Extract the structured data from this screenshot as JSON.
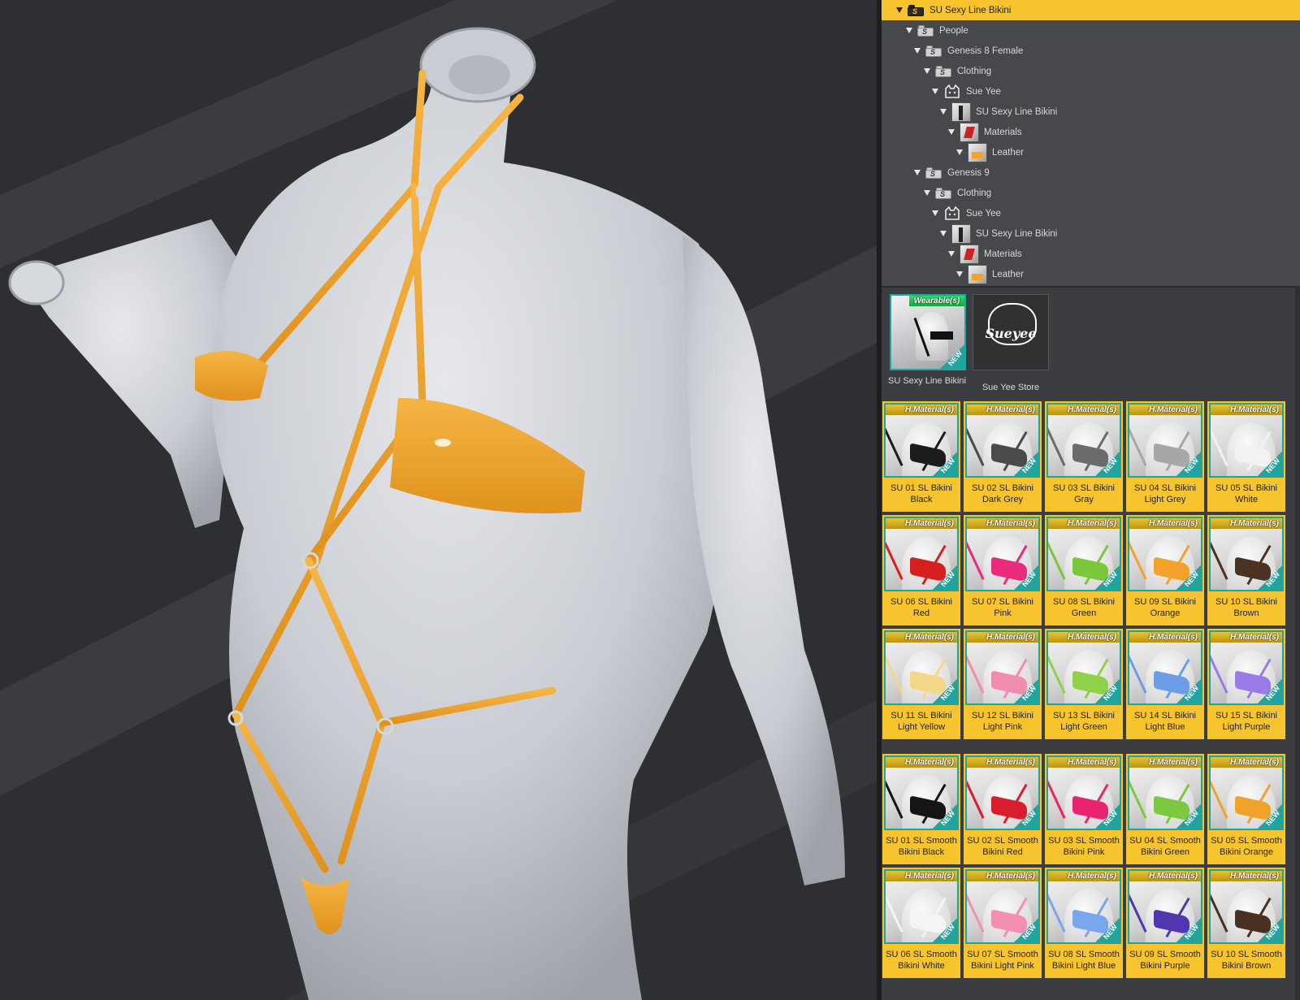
{
  "tree": [
    {
      "label": "SU Sexy Line Bikini",
      "icon": "folder-icon",
      "selected": true,
      "level": 0
    },
    {
      "label": "People",
      "icon": "folder-icon",
      "level": 1
    },
    {
      "label": "Genesis 8 Female",
      "icon": "folder-icon",
      "level": 2
    },
    {
      "label": "Clothing",
      "icon": "folder-icon",
      "level": 3
    },
    {
      "label": "Sue Yee",
      "icon": "cat-icon",
      "level": 4
    },
    {
      "label": "SU Sexy Line Bikini",
      "icon": "product-thumb-icon",
      "level": 5
    },
    {
      "label": "Materials",
      "icon": "materials-thumb-icon",
      "level": 6
    },
    {
      "label": "Leather",
      "icon": "leather-thumb-icon",
      "level": 7
    },
    {
      "label": "Genesis 9",
      "icon": "folder-icon",
      "level": 2
    },
    {
      "label": "Clothing",
      "icon": "folder-icon",
      "level": 3
    },
    {
      "label": "Sue Yee",
      "icon": "cat-icon",
      "level": 4
    },
    {
      "label": "SU Sexy Line Bikini",
      "icon": "product-thumb-icon",
      "level": 5
    },
    {
      "label": "Materials",
      "icon": "materials-thumb-icon",
      "level": 6
    },
    {
      "label": "Leather",
      "icon": "leather-thumb-icon",
      "level": 7
    }
  ],
  "wearables": [
    {
      "badge": "Wearable(s)",
      "new": "NEW",
      "label": "SU Sexy Line Bikini"
    },
    {
      "logo": "Sueyee",
      "label": "Sue Yee Store"
    }
  ],
  "badge_label": "H.Material(s)",
  "new_label": "NEW",
  "materials": [
    {
      "line1": "SU 01 SL Bikini",
      "line2": "Black",
      "color": "#1c1c1c"
    },
    {
      "line1": "SU 02 SL Bikini",
      "line2": "Dark Grey",
      "color": "#4a4a4a"
    },
    {
      "line1": "SU 03 SL Bikini",
      "line2": "Gray",
      "color": "#6b6b6b"
    },
    {
      "line1": "SU 04 SL Bikini",
      "line2": "Light Grey",
      "color": "#a7a7a7"
    },
    {
      "line1": "SU 05 SL Bikini",
      "line2": "White",
      "color": "#f2f2f2"
    },
    {
      "line1": "SU 06 SL Bikini",
      "line2": "Red",
      "color": "#d62020"
    },
    {
      "line1": "SU 07 SL Bikini",
      "line2": "Pink",
      "color": "#ea2a7a"
    },
    {
      "line1": "SU 08 SL Bikini",
      "line2": "Green",
      "color": "#7ac83a"
    },
    {
      "line1": "SU 09 SL Bikini",
      "line2": "Orange",
      "color": "#f2a12a"
    },
    {
      "line1": "SU 10 SL Bikini",
      "line2": "Brown",
      "color": "#4b3322"
    },
    {
      "line1": "SU 11 SL Bikini",
      "line2": "Light Yellow",
      "color": "#f3d88a"
    },
    {
      "line1": "SU 12 SL Bikini",
      "line2": "Light Pink",
      "color": "#f28cad"
    },
    {
      "line1": "SU 13 SL Bikini",
      "line2": "Light Green",
      "color": "#8fd24a"
    },
    {
      "line1": "SU 14 SL Bikini",
      "line2": "Light Blue",
      "color": "#6e9de8"
    },
    {
      "line1": "SU 15 SL Bikini",
      "line2": "Light Purple",
      "color": "#9a7ae6"
    },
    {
      "line1": "SU 01 SL Smooth",
      "line2": "Bikini Black",
      "color": "#151515"
    },
    {
      "line1": "SU 02 SL Smooth",
      "line2": "Bikini Red",
      "color": "#d81e2c"
    },
    {
      "line1": "SU 03 SL Smooth",
      "line2": "Bikini Pink",
      "color": "#e8246e"
    },
    {
      "line1": "SU 04 SL Smooth",
      "line2": "Bikini Green",
      "color": "#7cc840"
    },
    {
      "line1": "SU 05 SL Smooth",
      "line2": "Bikini Orange",
      "color": "#f1a229"
    },
    {
      "line1": "SU 06 SL Smooth",
      "line2": "Bikini White",
      "color": "#f4f4f4"
    },
    {
      "line1": "SU 07 SL Smooth",
      "line2": "Bikini Light Pink",
      "color": "#f28fb3"
    },
    {
      "line1": "SU 08 SL Smooth",
      "line2": "Bikini Light Blue",
      "color": "#7aa6ec"
    },
    {
      "line1": "SU 09 SL Smooth",
      "line2": "Bikini Purple",
      "color": "#5236b0"
    },
    {
      "line1": "SU 10 SL Smooth",
      "line2": "Bikini Brown",
      "color": "#4a3020"
    }
  ],
  "colors": {
    "accent": "#f7c42e",
    "teal": "#1fa4a0",
    "garment": "#f2a12a"
  }
}
